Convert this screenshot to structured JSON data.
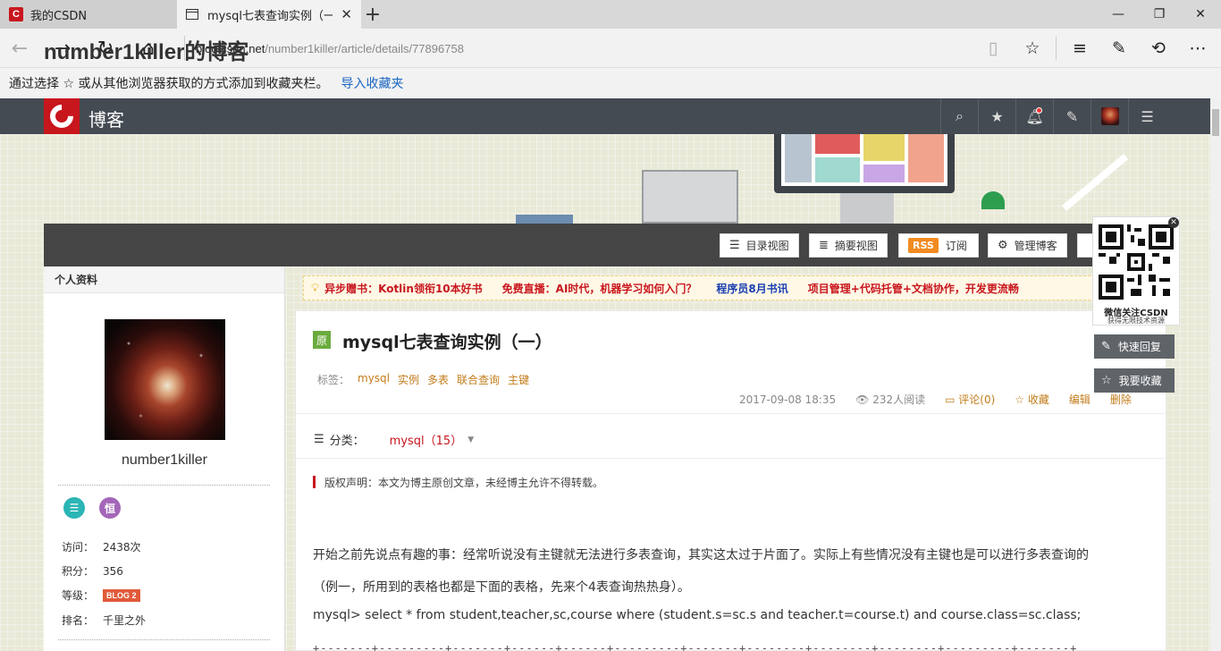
{
  "browser": {
    "tabs": [
      {
        "label": "我的CSDN"
      },
      {
        "label": "mysql七表查询实例（一"
      }
    ],
    "new_tab_glyph": "+",
    "url_host": "blog.csdn.net",
    "url_path": "/number1killer/article/details/77896758",
    "favorites_hint": "通过选择 ☆ 或从其他浏览器获取的方式添加到收藏夹栏。",
    "favorites_import": "导入收藏夹"
  },
  "csdn_nav": {
    "brand": "博客"
  },
  "blog": {
    "title": "number1killer的博客"
  },
  "toolbar": {
    "buttons": [
      {
        "label": "目录视图",
        "icon": "list-icon"
      },
      {
        "label": "摘要视图",
        "icon": "summary-icon"
      },
      {
        "label": "订阅",
        "icon": "rss-icon",
        "badge": "RSS"
      },
      {
        "label": "管理博客",
        "icon": "gear-icon"
      }
    ]
  },
  "sidebar": {
    "heading": "个人资料",
    "username": "number1killer",
    "stats": [
      {
        "key": "访问：",
        "value": "2438次"
      },
      {
        "key": "积分：",
        "value": "356"
      },
      {
        "key": "等级：",
        "value": "BLOG 2"
      },
      {
        "key": "排名：",
        "value": "千里之外"
      }
    ]
  },
  "notices": [
    {
      "text": "异步赠书：Kotlin领衔10本好书",
      "color": "#c8161d"
    },
    {
      "text": "免费直播：AI时代，机器学习如何入门？",
      "color": "#c8161d"
    },
    {
      "text": "程序员8月书讯",
      "color": "#1a3fb0"
    },
    {
      "text": "项目管理+代码托管+文档协作，开发更流畅",
      "color": "#c8161d"
    }
  ],
  "article": {
    "original_badge": "原",
    "title": "mysql七表查询实例（一）",
    "tags_label": "标签：",
    "tags": [
      "mysql",
      "实例",
      "多表",
      "联合查询",
      "主键"
    ],
    "date": "2017-09-08 18:35",
    "views": "232人阅读",
    "comments": "评论(0)",
    "favorite": "收藏",
    "edit": "编辑",
    "delete": "删除",
    "category_label": "分类：",
    "category_value": "mysql（15）",
    "copyright": "版权声明：本文为博主原创文章，未经博主允许不得转载。",
    "para1": "开始之前先说点有趣的事：经常听说没有主键就无法进行多表查询，其实这太过于片面了。实际上有些情况没有主键也是可以进行多表查询的",
    "para2": "（例一，所用到的表格也都是下面的表格，先来个4表查询热热身）。",
    "sql": "mysql> select * from student,teacher,sc,course where (student.s=sc.s and teacher.t=course.t) and course.class=sc.class;",
    "dashes": "+-------+---------+-------+------+------+---------+-------+--------+--------+--------+---------+-------+"
  },
  "floating": {
    "qr_caption1": "微信关注CSDN",
    "qr_caption2": "获得无限技术资源",
    "quick_reply": "快速回复",
    "collect": "我要收藏"
  }
}
